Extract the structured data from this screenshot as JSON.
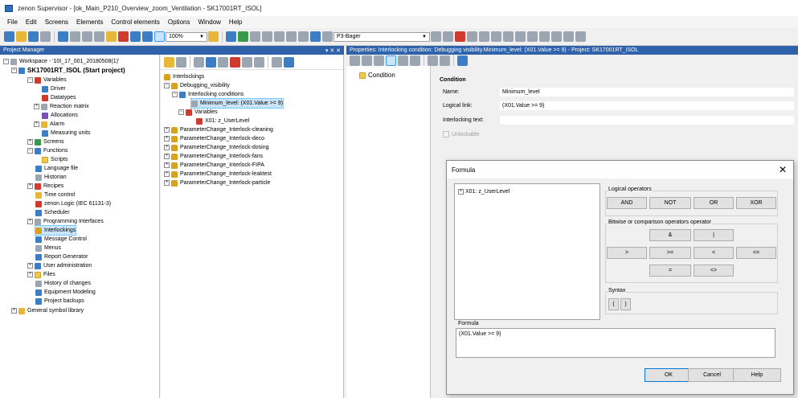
{
  "window": {
    "title": "zenon Supervisor - [ok_Main_P210_Overview_zoom_Ventilation - SK17001RT_ISOL]"
  },
  "menu": [
    "File",
    "Edit",
    "Screens",
    "Elements",
    "Control elements",
    "Options",
    "Window",
    "Help"
  ],
  "toolbar": {
    "zoom_value": "100%",
    "role_value": "P3-Bager"
  },
  "project_manager": {
    "title": "Project Manager",
    "pin_label": "▾ ✕ ✕",
    "workspace_label": "Workspace - '10I_17_001_20180508(1)'",
    "project_label": "SK17001RT_ISOL (Start project)",
    "items": [
      {
        "label": "Variables"
      },
      {
        "label": "Driver"
      },
      {
        "label": "Datatypes"
      },
      {
        "label": "Reaction matrix"
      },
      {
        "label": "Allocations"
      },
      {
        "label": "Alarm"
      },
      {
        "label": "Measuring units"
      },
      {
        "label": "Screens"
      },
      {
        "label": "Functions"
      },
      {
        "label": "Scripts"
      },
      {
        "label": "Language file"
      },
      {
        "label": "Historian"
      },
      {
        "label": "Recipes"
      },
      {
        "label": "Time control"
      },
      {
        "label": "zenon Logic (IEC 61131-3)"
      },
      {
        "label": "Scheduler"
      },
      {
        "label": "Programming Interfaces"
      },
      {
        "label": "Interlockings"
      },
      {
        "label": "Message Control"
      },
      {
        "label": "Menus"
      },
      {
        "label": "Report Generator"
      },
      {
        "label": "User administration"
      },
      {
        "label": "Files"
      },
      {
        "label": "History of changes"
      },
      {
        "label": "Equipment Modeling"
      },
      {
        "label": "Project backups"
      }
    ],
    "general_library": "General symbol library"
  },
  "interlock_tree": {
    "root": "Interlockings",
    "debug": "Debugging_visibility",
    "conditions": "Interlocking conditions",
    "condition_item": "Minimum_level: (X01.Value >= 9)",
    "variables": "Variables",
    "variable_item": "X01: z_UserLevel",
    "others": [
      "ParameterChange_Interlock-cleaning",
      "ParameterChange_Interlock-deco",
      "ParameterChange_Interlock-dosing",
      "ParameterChange_Interlock-fans",
      "ParameterChange_Interlock-FIPA",
      "ParameterChange_Interlock-leaktest",
      "ParameterChange_Interlock-particle"
    ]
  },
  "properties": {
    "header": "Properties: Interlocking condition: Debugging visibility.Minimum_level: (X01.Value >= 9) - Project: SK17001RT_ISOL",
    "tree_item": "Condition",
    "section": "Condition",
    "name_label": "Name:",
    "name_value": "Minimum_level",
    "link_label": "Logical link:",
    "link_value": "(X01.Value >= 9)",
    "text_label": "Interlocking text:",
    "text_value": "",
    "unlockable_label": "Unlockable"
  },
  "formula_dialog": {
    "title": "Formula",
    "variable_entry": "X01: z_UserLevel",
    "logical_title": "Logical operators",
    "logical_ops": [
      "AND",
      "NOT",
      "OR",
      "XOR"
    ],
    "bitwise_title": "Bitwise or comparison operators operator",
    "bit_ops_row1": [
      "&",
      "|"
    ],
    "cmp_row": [
      ">",
      ">=",
      "<",
      "<="
    ],
    "eq_row": [
      "=",
      "<>"
    ],
    "syntax_title": "Syntax",
    "syntax_ops": [
      "(",
      ")"
    ],
    "formula_title": "Formula",
    "formula_value": "(X01.Value >= 9)",
    "ok_label": "OK",
    "cancel_label": "Cancel",
    "help_label": "Help"
  }
}
